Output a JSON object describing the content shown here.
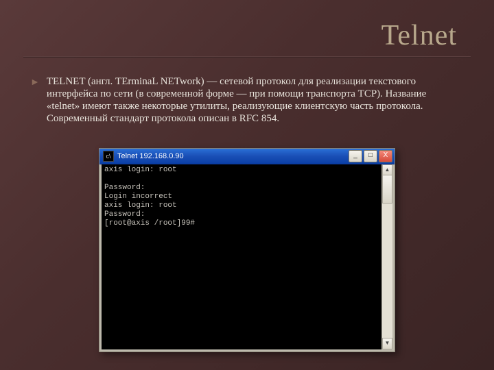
{
  "title": "Telnet",
  "bullet_glyph": "►",
  "paragraph": "TELNET (англ.  TErminaL NETwork) — сетевой протокол для реализации текстового интерфейса по сети (в современной форме — при помощи транспорта TCP). Название «telnet» имеют также некоторые утилиты, реализующие клиентскую часть протокола. Современный стандарт протокола описан в RFC 854.",
  "window": {
    "icon_glyph": "c\\",
    "title": "Telnet 192.168.0.90",
    "min": "_",
    "max": "□",
    "close": "X",
    "scroll_up": "▲",
    "scroll_down": "▼"
  },
  "terminal_lines": "axis login: root\n\nPassword:\nLogin incorrect\naxis login: root\nPassword:\n[root@axis /root]99#"
}
